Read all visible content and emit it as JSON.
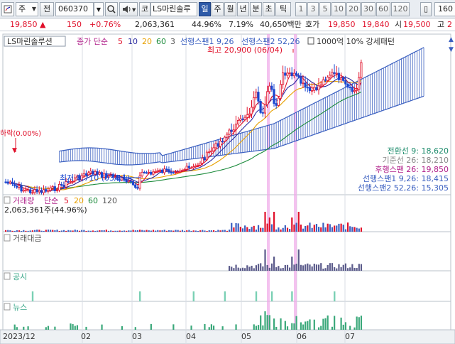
{
  "toolbar": {
    "market": "주",
    "period": "전",
    "code": "060370",
    "name_prefix": "코",
    "name": "LS마린솔루",
    "tabs": [
      "일",
      "주",
      "월",
      "년",
      "분",
      "초",
      "틱"
    ],
    "active_tab": "일",
    "numbers": [
      "1",
      "3",
      "5",
      "10",
      "20",
      "30",
      "60",
      "120"
    ],
    "count": "160"
  },
  "quote": {
    "price": "19,850",
    "change": "150",
    "change_pct": "+0.76%",
    "volume": "2,063,361",
    "turnover_pct": "44.96%",
    "ratio": "7.19%",
    "amount": "40,650백만",
    "hoga_label": "호가",
    "ask": "19,850",
    "bid": "19,840",
    "open_label": "시",
    "open": "19,500",
    "high_label": "고",
    "high": "2"
  },
  "price_panel": {
    "legend_name": "LS마린솔루션",
    "legend_ma": "종가 단순",
    "ma_periods": [
      "5",
      "10",
      "20",
      "60",
      "3"
    ],
    "legend_ichimoku": [
      "선행스팬1 9,26",
      "선행스팬2 52,26"
    ],
    "legend_extra": "1000억 10% 강세패턴",
    "high_label": "최고 20,900 (06/04)",
    "low_label": "최저 8,710 (03/11)",
    "drop_label": "하락(0.00%)",
    "ichi_values": [
      {
        "label": "전환선 9: 18,620",
        "color": "#1a8a6a"
      },
      {
        "label": "기준선 26: 18,210",
        "color": "#888888"
      },
      {
        "label": "후행스팬 26: 19,850",
        "color": "#b0208a"
      },
      {
        "label": "선행스팬1 9,26: 18,415",
        "color": "#3a5fc0"
      },
      {
        "label": "선행스팬2 52,26: 15,305",
        "color": "#3a5fc0"
      }
    ]
  },
  "volume_panel": {
    "legend": "거래량",
    "legend_ma": "단순",
    "ma_periods": [
      "5",
      "20",
      "60",
      "120"
    ],
    "value": "2,063,361주(44.96%)"
  },
  "amount_panel": {
    "legend": "거래대금"
  },
  "disclosure_panel": {
    "legend": "공시"
  },
  "news_panel": {
    "legend": "뉴스"
  },
  "xaxis": {
    "labels": [
      "2023/12",
      "02",
      "03",
      "04",
      "05",
      "06",
      "07"
    ]
  },
  "colors": {
    "up": "#e0102a",
    "down": "#1846d0",
    "cloud": "#3a5fc0",
    "highlight": "#f0a8e8",
    "ma5": "#e0102a",
    "ma10": "#2a2aa0",
    "ma20": "#e8a000",
    "ma60": "#1a8a3a"
  }
}
